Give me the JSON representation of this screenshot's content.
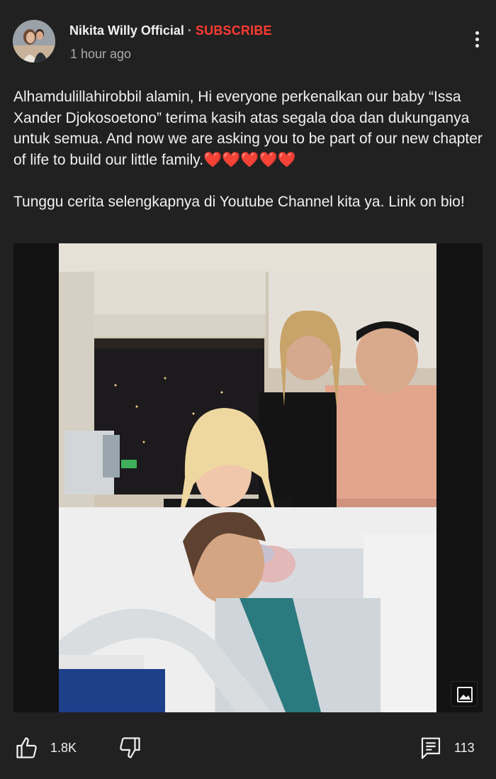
{
  "post": {
    "channel_name": "Nikita Willy Official",
    "separator": "·",
    "subscribe_label": "SUBSCRIBE",
    "time_ago": "1 hour ago",
    "menu_icon": "more-vert-icon",
    "paragraph1": "Alhamdulillahirobbil alamin, Hi everyone perkenalkan our baby “Issa Xander Djokosoetono” terima kasih atas segala doa dan dukunganya untuk semua. And now we are asking you to be part of our new chapter of life to build our little family.",
    "hearts": "❤️❤️❤️❤️❤️",
    "paragraph2": "Tunggu cerita selengkapnya di Youtube Channel kita ya. Link on bio!",
    "image_badge_icon": "image-icon"
  },
  "actions": {
    "like_icon": "thumbs-up-icon",
    "like_count": "1.8K",
    "dislike_icon": "thumbs-down-icon",
    "comment_icon": "comment-icon",
    "comment_count": "113"
  },
  "colors": {
    "background": "#212121",
    "subscribe": "#ff3b30",
    "secondary_text": "#aaaaaa"
  }
}
